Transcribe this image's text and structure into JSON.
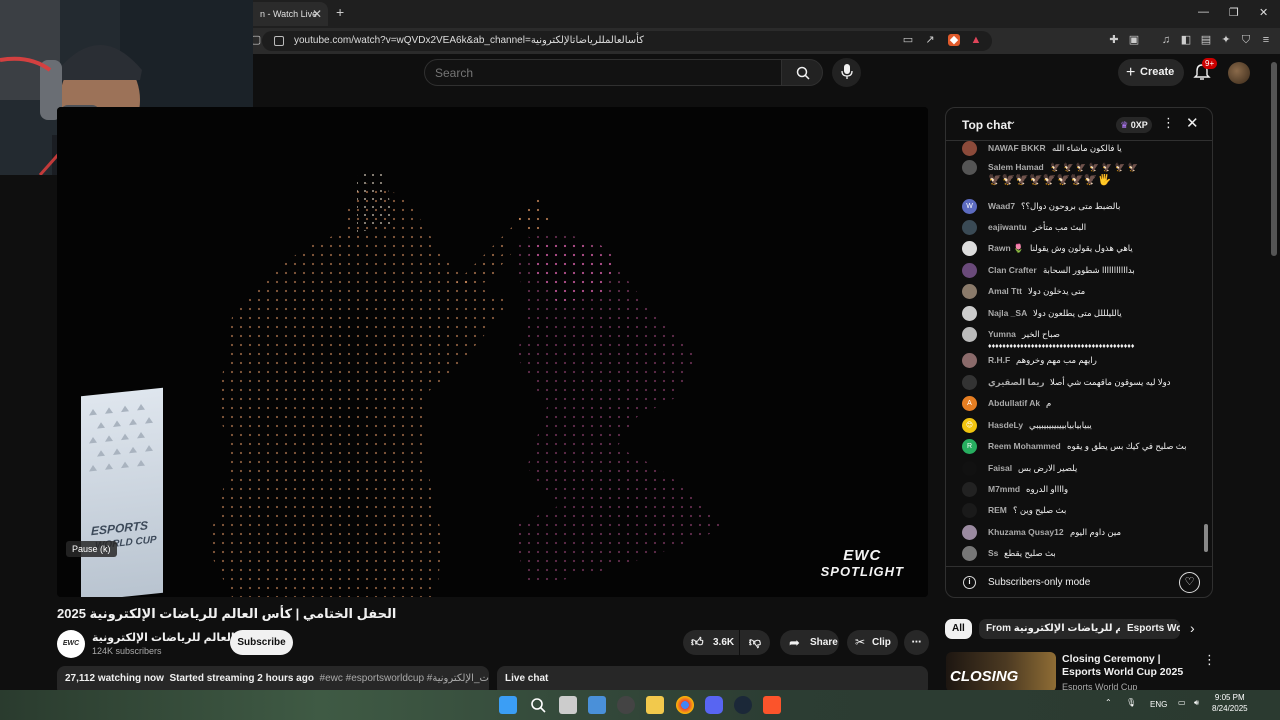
{
  "browser": {
    "tab_title": "n - Watch Live",
    "url": "youtube.com/watch?v=wQVDx2VEA6k&ab_channel=كأسالعالمللرياضاتالإلكترونية"
  },
  "header": {
    "search_placeholder": "Search",
    "create_label": "Create",
    "notification_count": "9+"
  },
  "player": {
    "pause_tooltip": "Pause (k)",
    "logo_top": "EWC",
    "logo_bottom": "SPOTLIGHT"
  },
  "video": {
    "title": "الحفل الختامي | كأس العالم للرياضات الإلكترونية 2025",
    "channel_name": "كأس العالم للرياضات الإلكترونية",
    "channel_avatar_text": "EWC",
    "subscribers": "124K subscribers",
    "subscribe_label": "Subscribe",
    "likes": "3.6K",
    "share_label": "Share",
    "clip_label": "Clip",
    "watching": "27,112 watching now",
    "started": "Started streaming 2 hours ago",
    "tags": "#ewc #esportsworldcup #كأس_العالم_للرياضات_الإلكترونية",
    "live_chat_label": "Live chat"
  },
  "chat": {
    "title": "Top chat",
    "xp": "0XP",
    "footer_text": "Subscribers-only mode",
    "messages": [
      {
        "name": "NAWAF BKKR",
        "text": "يا فالكون ماشاء الله",
        "initial": "",
        "color": "#8b4a3a"
      },
      {
        "name": "Salem Hamad",
        "text": "🦅 🦅 🦅 🦅 🦅 🦅 🦅",
        "text2": "🦅🦅🦅🦅🦅🦅🦅🦅🖐",
        "initial": "",
        "color": "#555"
      },
      {
        "name": "Waad7",
        "text": "بالضبط متى بروحون دوال؟؟",
        "initial": "W",
        "color": "#5c6bc0"
      },
      {
        "name": "eajiwantu",
        "text": "البث مب متأخر",
        "initial": "",
        "color": "#3a4a55"
      },
      {
        "name": "Rawn 🌷",
        "text": "ياهي هذول يقولون وش يقولنا",
        "initial": "",
        "color": "#ddd"
      },
      {
        "name": "Clan Crafter",
        "text": "بدااااااااااا شطوور السحابة",
        "initial": "",
        "color": "#6a4a7a"
      },
      {
        "name": "Amal Ttt",
        "text": "متى يدخلون دولا",
        "initial": "",
        "color": "#8a7a6a"
      },
      {
        "name": "Najla _SA",
        "text": "يالليلللل متى يطلعون دولا",
        "initial": "",
        "color": "#ccc"
      },
      {
        "name": "Yumna",
        "text": "صباح الخير",
        "text2": "♦♦♦♦♦♦♦♦♦♦♦♦♦♦♦♦♦♦♦♦♦♦♦♦♦♦♦♦♦♦♦♦♦♦♦♦♦♦♦♦♦",
        "initial": "",
        "color": "#bbb"
      },
      {
        "name": "R.H.F",
        "text": "رايهم مب مهم وخروهم",
        "initial": "",
        "color": "#8a6a6a"
      },
      {
        "name": "ريما الصقيري",
        "text": "دولا ليه يسوقون ماقهمت شي أصلا",
        "initial": "",
        "color": "#333"
      },
      {
        "name": "Abdullatif Ak",
        "text": "م",
        "initial": "A",
        "color": "#e67e22"
      },
      {
        "name": "HasdeLy",
        "text": "يبيابيابيابييبيبيبيبيبي",
        "initial": "😊",
        "color": "#f1c40f"
      },
      {
        "name": "Reem Mohammed",
        "text": "بث صليح في كيك بس يطق و يقوه",
        "initial": "R",
        "color": "#27ae60"
      },
      {
        "name": "Faisal",
        "text": "يلصير الارض بس",
        "initial": "",
        "color": "#111"
      },
      {
        "name": "M7mmd",
        "text": "وااااو الدروه",
        "initial": "",
        "color": "#222"
      },
      {
        "name": "REM",
        "text": "بث صليح وين ؟",
        "initial": "",
        "color": "#1a1a1a"
      },
      {
        "name": "Khuzama Qusay12",
        "text": "مين داوم اليوم",
        "initial": "",
        "color": "#9a8aa0"
      },
      {
        "name": "Ss",
        "text": "بث صليح يقطع",
        "initial": "",
        "color": "#777"
      }
    ]
  },
  "chips": [
    "All",
    "From كأس العالم للرياضات الإلكترونية",
    "Esports Wo"
  ],
  "recommendation": {
    "thumb_text": "CLOSING",
    "title": "Closing Ceremony | Esports World Cup 2025",
    "channel": "Esports World Cup"
  },
  "taskbar": {
    "lang": "ENG",
    "time": "9:05 PM",
    "date": "8/24/2025"
  }
}
